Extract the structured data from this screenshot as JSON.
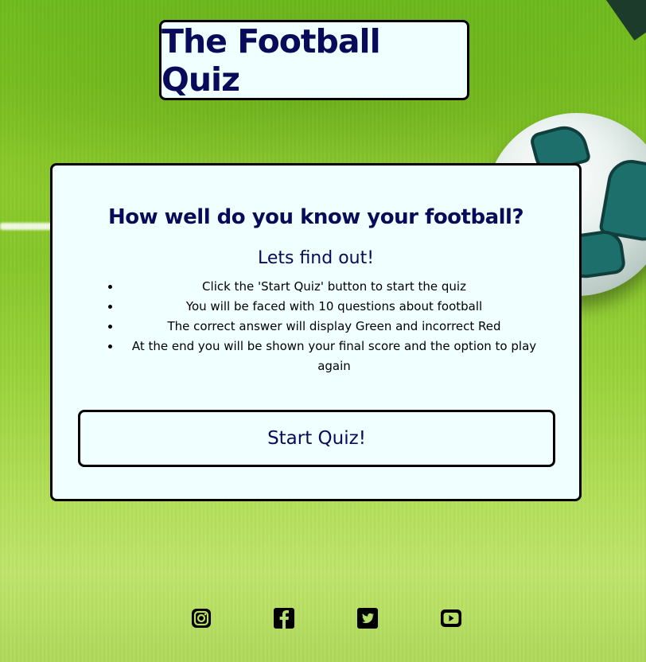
{
  "header": {
    "title": "The Football Quiz"
  },
  "intro": {
    "heading": "How well do you know your football?",
    "subheading": "Lets find out!",
    "instructions": [
      "Click the 'Start Quiz' button to start the quiz",
      "You will be faced with 10 questions about football",
      "The correct answer will display Green and incorrect Red",
      "At the end you will be shown your final score and the option to play again"
    ],
    "start_button_label": "Start Quiz!"
  },
  "footer": {
    "social_links": [
      {
        "icon": "instagram-icon"
      },
      {
        "icon": "facebook-icon"
      },
      {
        "icon": "twitter-icon"
      },
      {
        "icon": "youtube-icon"
      }
    ]
  },
  "colors": {
    "panel_background": "#f0ffff",
    "heading_text": "#0a0a5a",
    "border": "#000000"
  }
}
